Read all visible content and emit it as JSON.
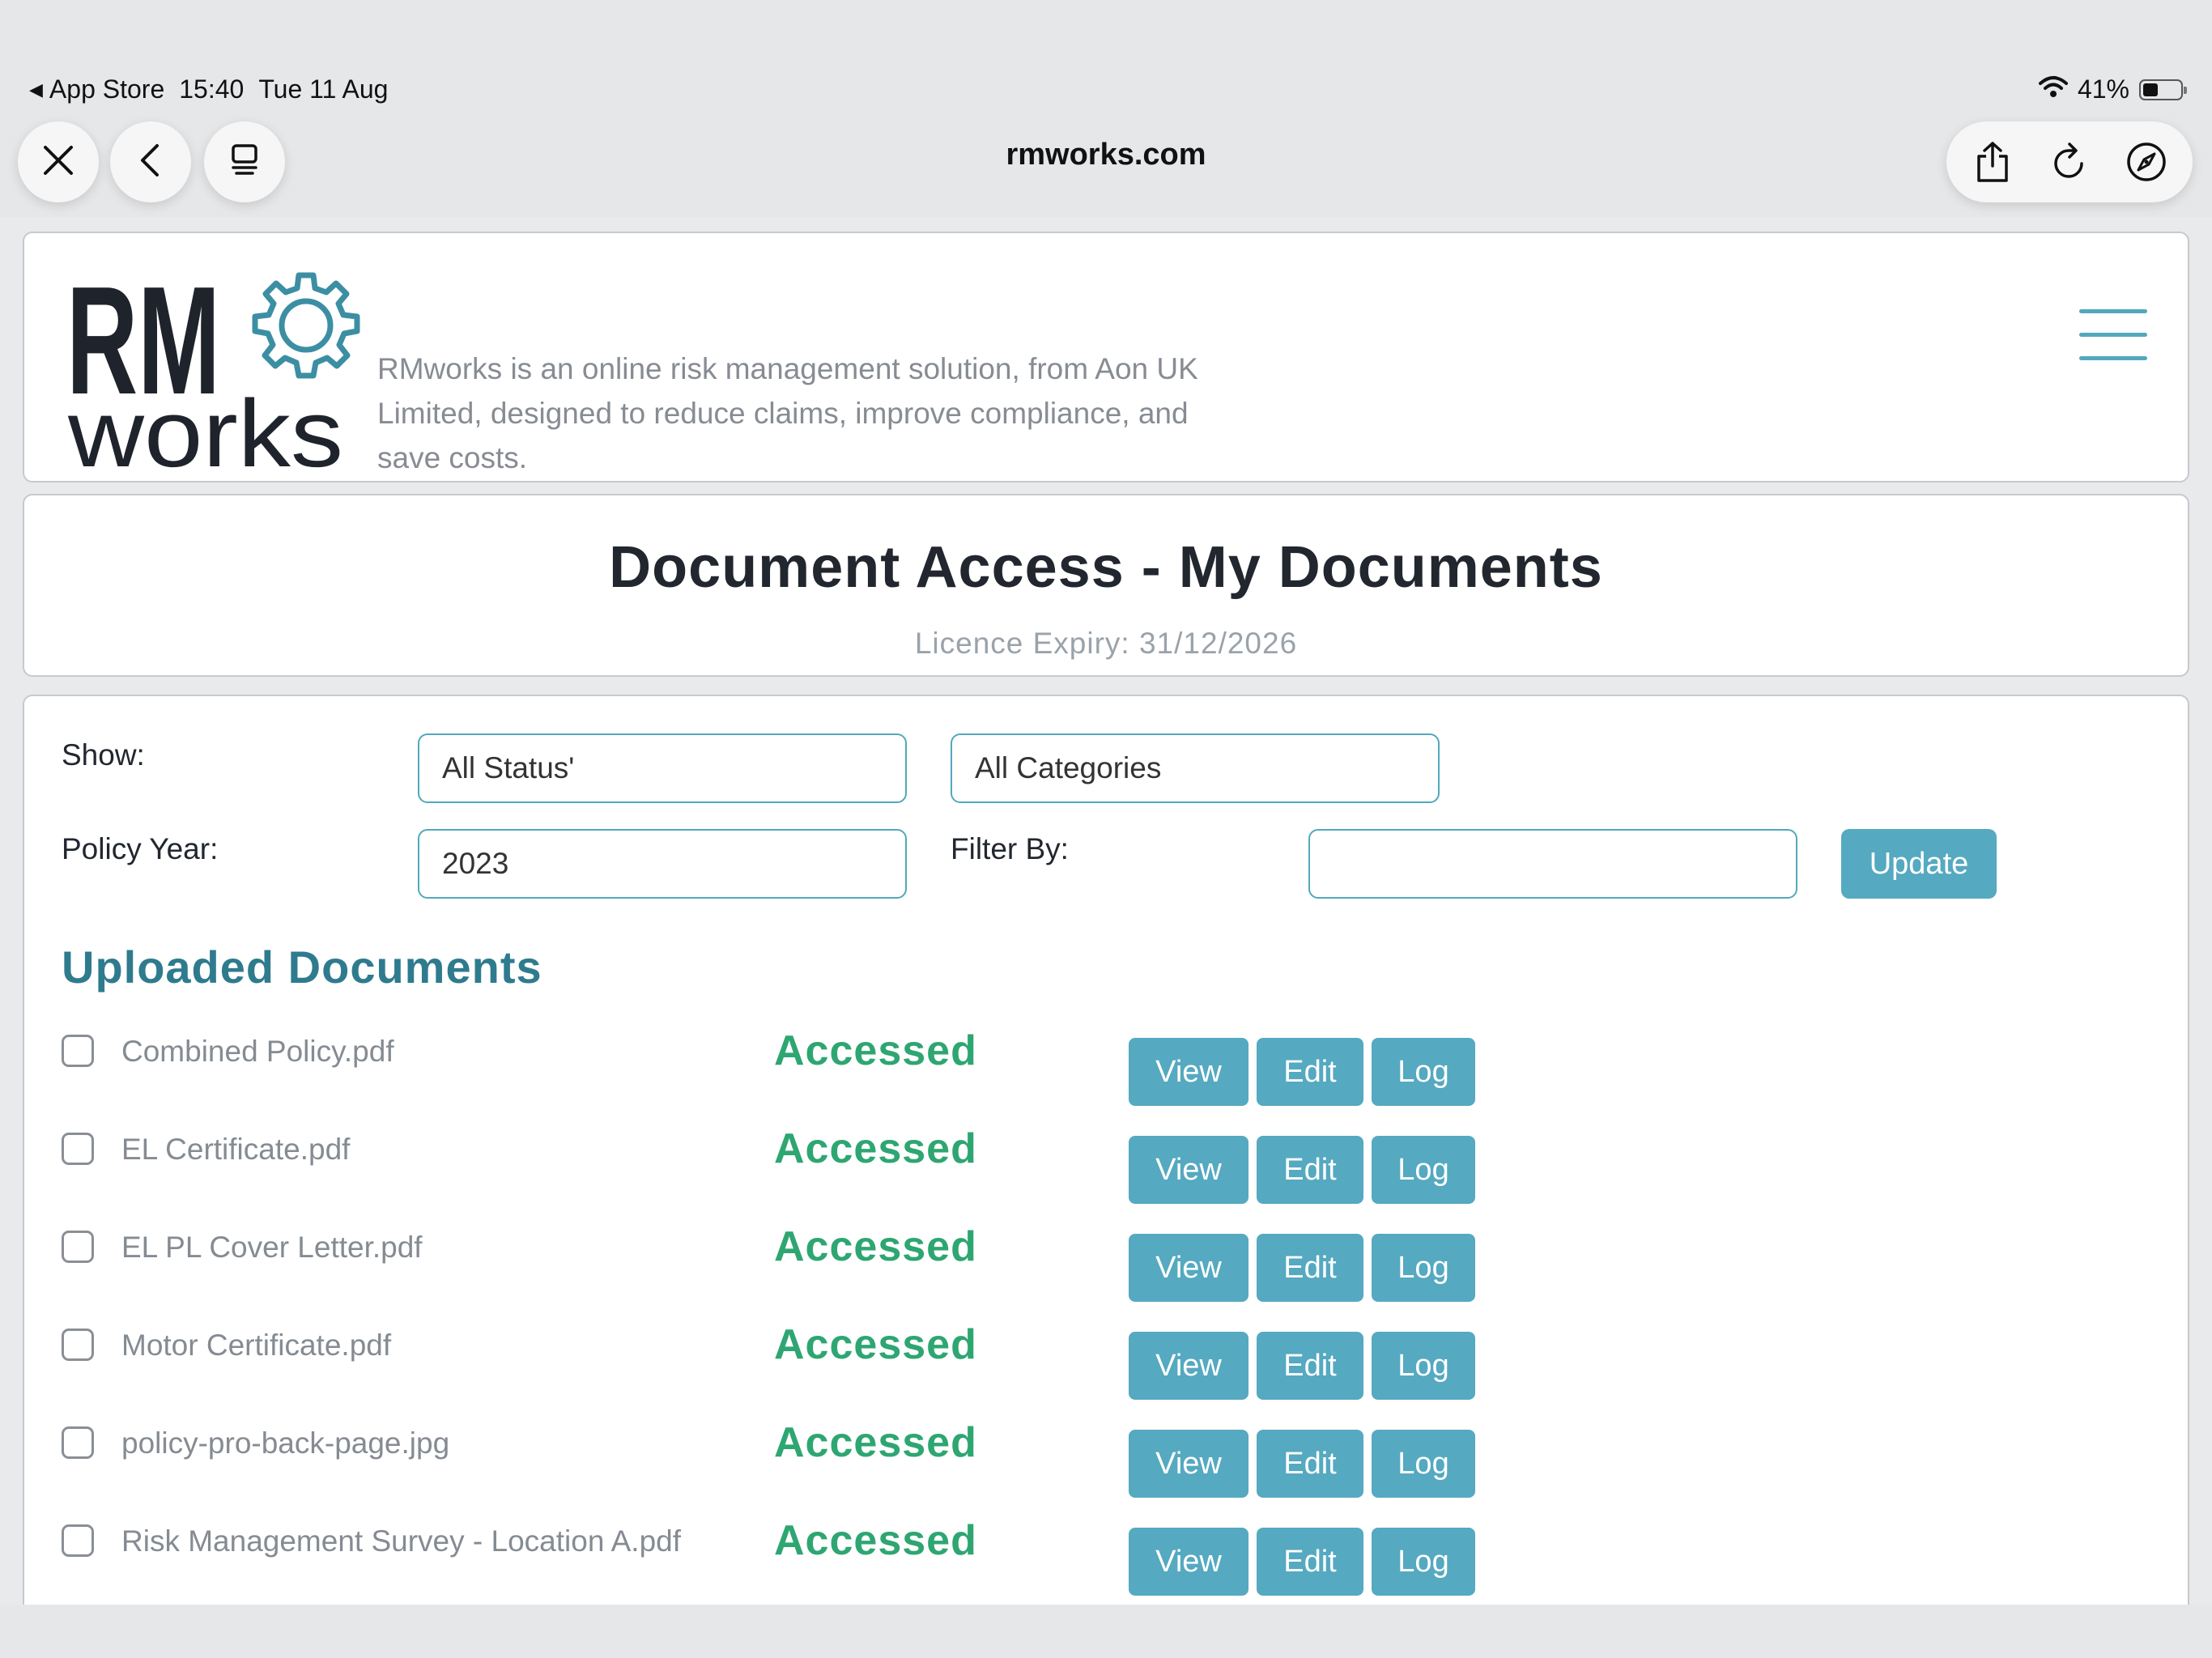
{
  "status_bar": {
    "back_app": "App Store",
    "time": "15:40",
    "date": "Tue 11 Aug",
    "battery_percent": "41%",
    "battery_level": 0.41
  },
  "browser": {
    "url": "rmworks.com",
    "icons": [
      "close-icon",
      "back-chevron-icon",
      "tabs-icon",
      "share-icon",
      "reload-icon",
      "compass-icon"
    ]
  },
  "header": {
    "logo_top": "RM",
    "logo_bottom": "works",
    "tagline": "RMworks is an online risk management solution, from Aon UK Limited, designed to reduce claims, improve compliance, and save costs."
  },
  "page": {
    "title": "Document Access - My Documents",
    "licence": "Licence Expiry: 31/12/2026"
  },
  "filters": {
    "show_label": "Show:",
    "status_value": "All Status'",
    "category_value": "All Categories",
    "year_label": "Policy Year:",
    "year_value": "2023",
    "filter_label": "Filter By:",
    "filter_value": "",
    "update_label": "Update"
  },
  "documents": {
    "title": "Uploaded Documents",
    "view_label": "View",
    "edit_label": "Edit",
    "log_label": "Log",
    "items": [
      {
        "name": "Combined Policy.pdf",
        "status": "Accessed"
      },
      {
        "name": "EL Certificate.pdf",
        "status": "Accessed"
      },
      {
        "name": "EL PL Cover Letter.pdf",
        "status": "Accessed"
      },
      {
        "name": "Motor Certificate.pdf",
        "status": "Accessed"
      },
      {
        "name": "policy-pro-back-page.jpg",
        "status": "Accessed"
      },
      {
        "name": "Risk Management Survey - Location A.pdf",
        "status": "Accessed"
      }
    ]
  },
  "colors": {
    "accent": "#55a9c0",
    "heading": "#2f7b8e",
    "accessed": "#2ea672"
  }
}
